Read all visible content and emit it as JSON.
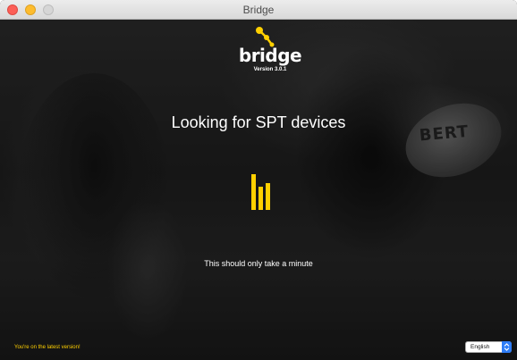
{
  "window": {
    "title": "Bridge"
  },
  "logo": {
    "name": "bridge",
    "version": "Version 3.0.1"
  },
  "main": {
    "heading": "Looking for SPT devices",
    "subtext": "This should only take a minute",
    "loader_icon": "bars-loading-icon",
    "accent_color": "#ffd000"
  },
  "background": {
    "ball_print": "BERT"
  },
  "footer": {
    "status": "You're on the latest version!",
    "language": {
      "selected": "English"
    }
  }
}
